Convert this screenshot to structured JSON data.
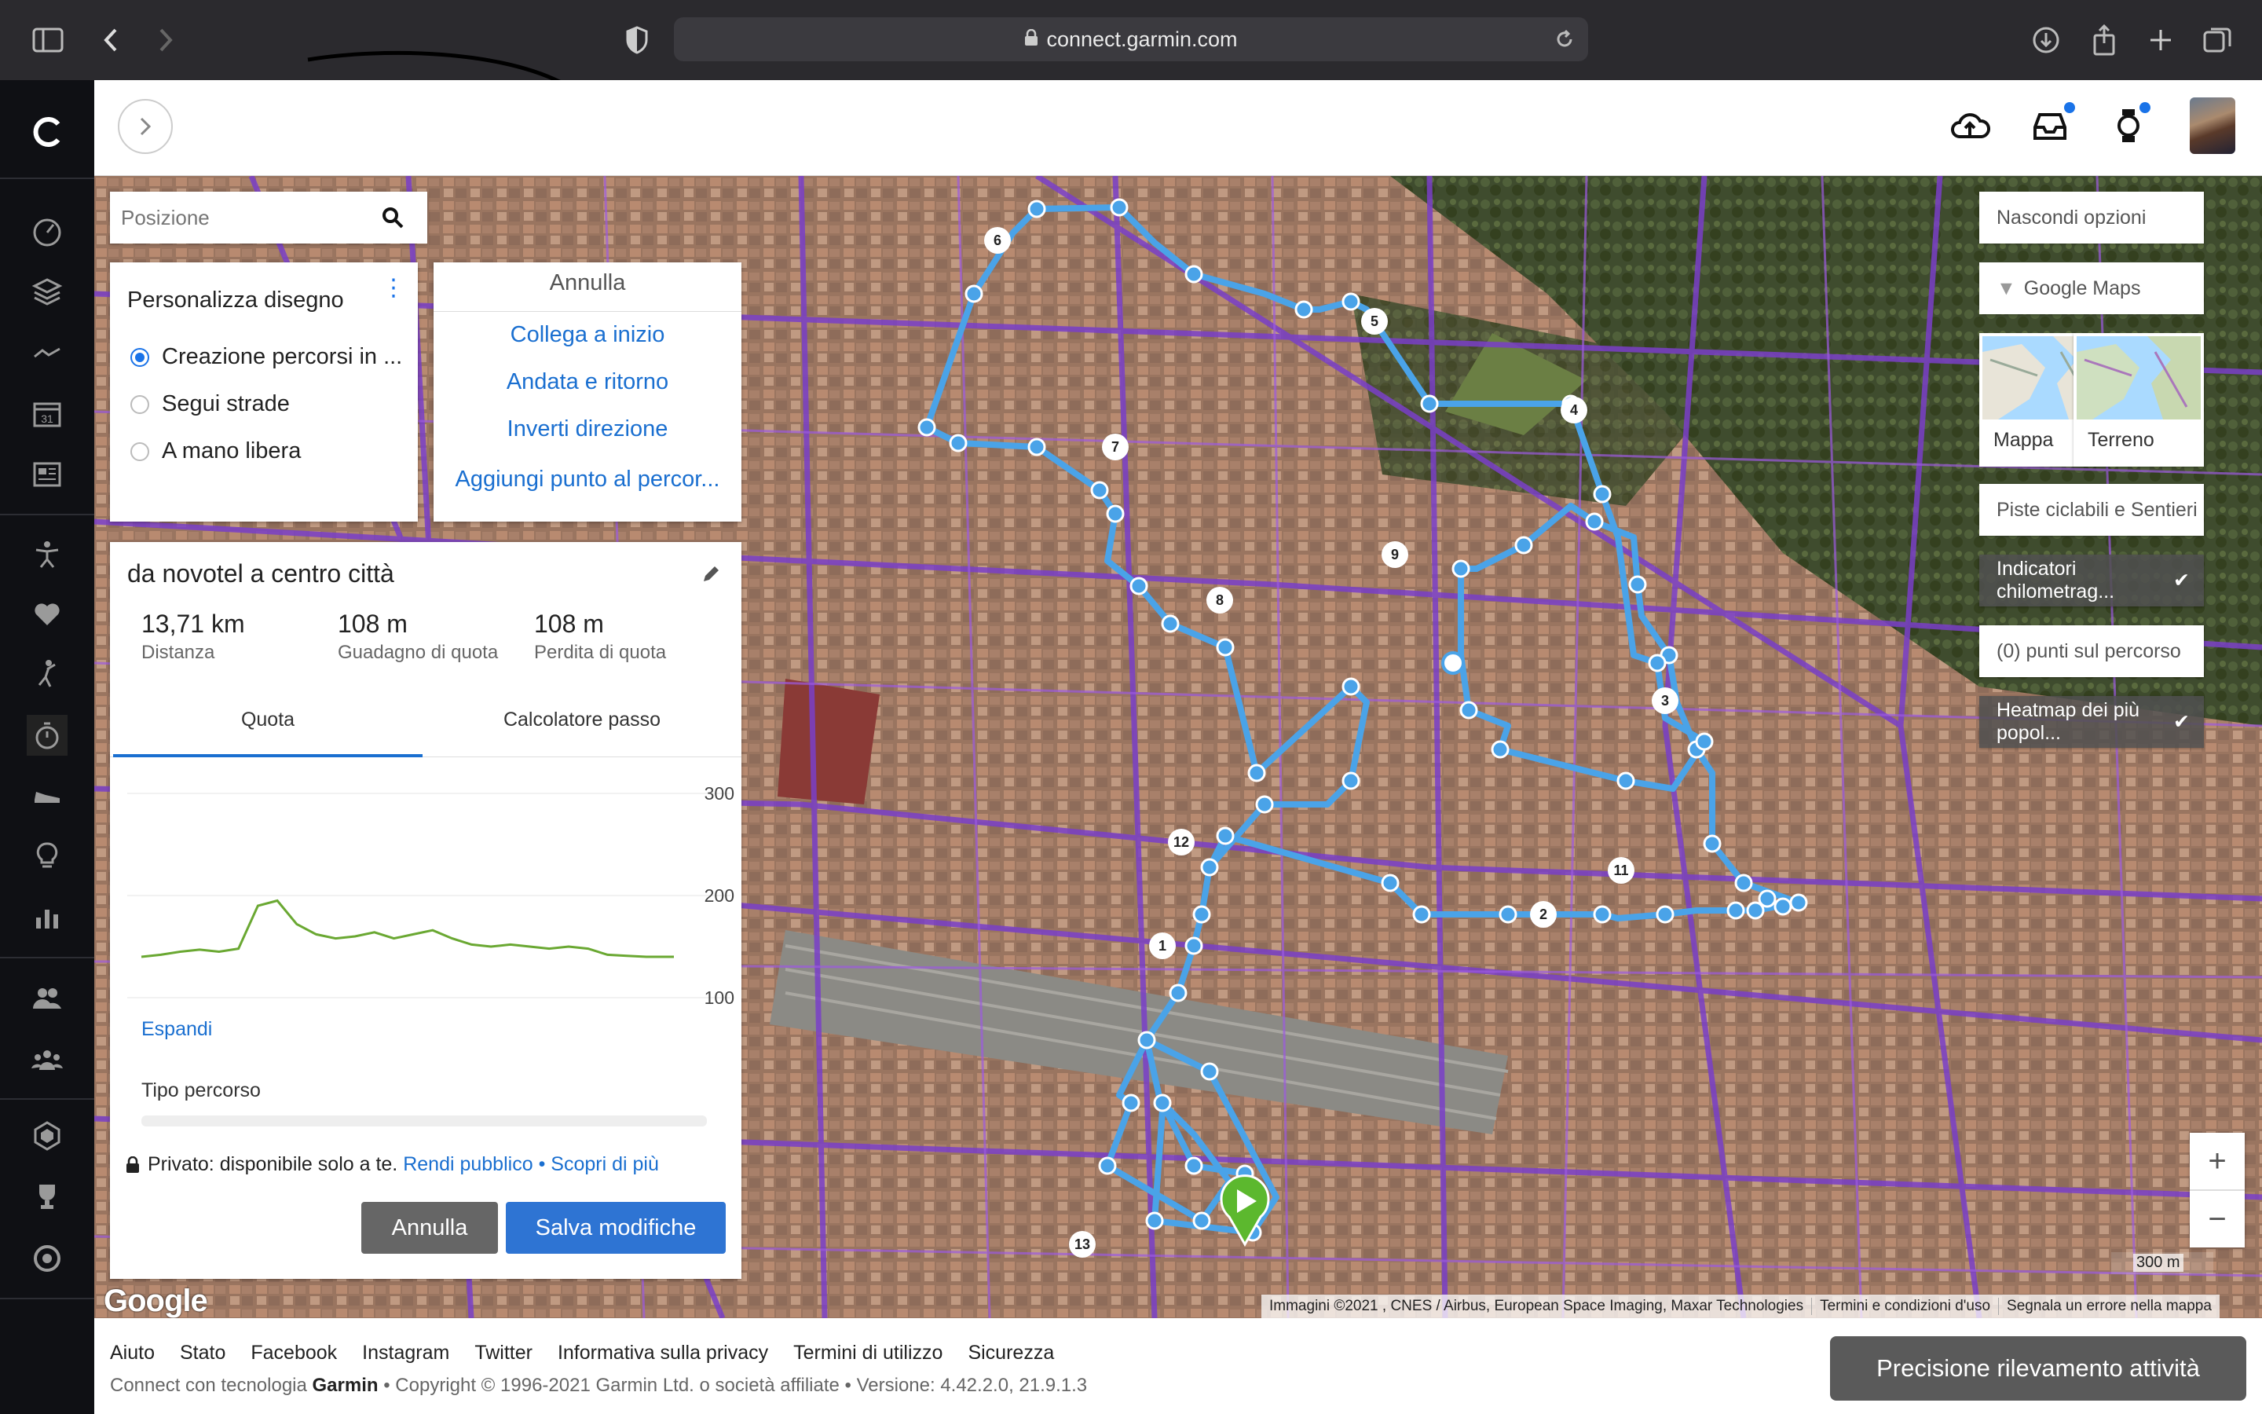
{
  "browser": {
    "url": "connect.garmin.com"
  },
  "search": {
    "placeholder": "Posizione"
  },
  "draw_panel": {
    "title": "Personalizza disegno",
    "options": [
      "Creazione percorsi in ...",
      "Segui strade",
      "A mano libera"
    ],
    "selected": 0
  },
  "action_panel": {
    "header": "Annulla",
    "actions": [
      "Collega a inizio",
      "Andata e ritorno",
      "Inverti direzione",
      "Aggiungi punto al percor..."
    ]
  },
  "route": {
    "name": "da novotel a centro città",
    "stats": [
      {
        "value": "13,71 km",
        "label": "Distanza"
      },
      {
        "value": "108 m",
        "label": "Guadagno di quota"
      },
      {
        "value": "108 m",
        "label": "Perdita di quota"
      }
    ],
    "tabs": [
      "Quota",
      "Calcolatore passo"
    ],
    "active_tab": "Quota",
    "expand_label": "Espandi",
    "route_type_label": "Tipo percorso",
    "privacy_text": "Privato: disponibile solo a te.",
    "privacy_link1": "Rendi pubblico",
    "privacy_sep": "•",
    "privacy_link2": "Scopri di più",
    "cancel_button": "Annulla",
    "save_button": "Salva modifiche"
  },
  "chart_data": {
    "type": "line",
    "title": "",
    "xlabel": "",
    "ylabel": "",
    "ylim": [
      100,
      300
    ],
    "y_ticks": [
      300,
      200,
      100
    ],
    "x": [
      0,
      0.5,
      1,
      1.5,
      2,
      2.5,
      3,
      3.5,
      4,
      4.5,
      5,
      5.5,
      6,
      6.5,
      7,
      7.5,
      8,
      8.5,
      9,
      9.5,
      10,
      10.5,
      11,
      11.5,
      12,
      12.5,
      13,
      13.71
    ],
    "series": [
      {
        "color": "#6aa832",
        "values": [
          140,
          142,
          145,
          147,
          145,
          148,
          190,
          195,
          172,
          162,
          158,
          160,
          164,
          158,
          162,
          166,
          158,
          152,
          150,
          152,
          150,
          148,
          150,
          148,
          142,
          141,
          140,
          140
        ]
      }
    ]
  },
  "map_options": {
    "hide": "Nascondi opzioni",
    "provider": "Google Maps",
    "types": [
      "Mappa",
      "Terreno"
    ],
    "bike": "Piste ciclabili e Sentieri",
    "km_markers": "Indicatori chilometrag...",
    "points": "(0) punti sul percorso",
    "heatmap": "Heatmap dei più popol..."
  },
  "map": {
    "scale": "300 m",
    "attribution": [
      "Immagini ©2021 , CNES / Airbus, European Space Imaging, Maxar Technologies",
      "Termini e condizioni d'uso",
      "Segnala un errore nella mappa"
    ],
    "google": "Google",
    "markers": [
      "1",
      "2",
      "3",
      "4",
      "5",
      "6",
      "7",
      "8",
      "9",
      "11",
      "12",
      "13"
    ]
  },
  "footer": {
    "links": [
      "Aiuto",
      "Stato",
      "Facebook",
      "Instagram",
      "Twitter",
      "Informativa sulla privacy",
      "Termini di utilizzo",
      "Sicurezza"
    ],
    "copy_prefix": "Connect con tecnologia",
    "copy_brand": "Garmin",
    "copy_suffix": "• Copyright © 1996-2021 Garmin Ltd. o società affiliate • Versione: 4.42.2.0, 21.9.1.3",
    "precision_button": "Precisione rilevamento attività"
  },
  "colors": {
    "accent": "#1a6fd0",
    "route": "#4aa3e8",
    "heatmap": "#8a3fd0",
    "elevation": "#6aa832"
  }
}
